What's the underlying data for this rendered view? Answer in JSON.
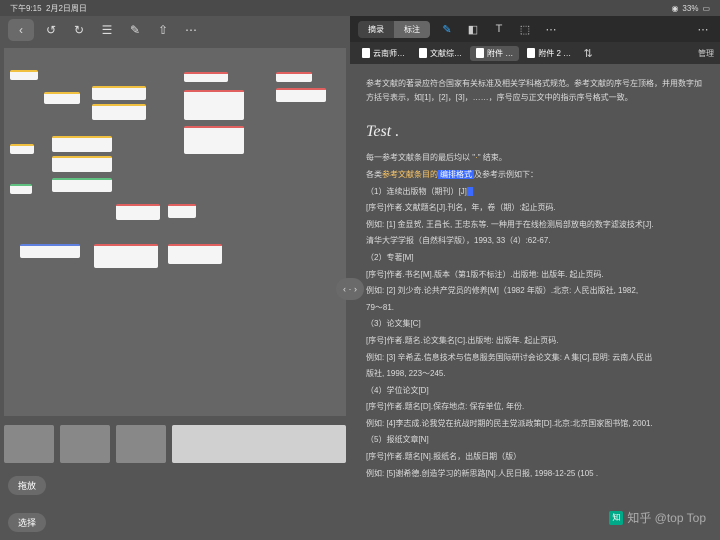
{
  "status": {
    "time": "下午9:15",
    "date": "2月2日周日",
    "battery": "33%"
  },
  "left": {
    "scale": "拖放",
    "select": "选择"
  },
  "seg": {
    "a": "摘录",
    "b": "标注"
  },
  "tabs": [
    "云南师…",
    "文献综…",
    "附件 …",
    "附件 2 …"
  ],
  "manage": "管理",
  "doc": {
    "p1": "参考文献的著录应符合国家有关标准及相关学科格式规范。参考文献的序号左顶格，并用数字加方括号表示，如[1]，[2]，[3]，……，序号应与正文中的指示序号格式一致。",
    "test": "Test .",
    "p2a": "每一参考文献条目的最后均以 \"",
    "p2b": "\" 结束。",
    "p3a": "各类",
    "p3b": "参考文献条目的",
    "p3c": "编排格式",
    "p3d": "及参考示例如下：",
    "s1": "（1）连续出版物（期刊）[J]",
    "s1a": "[序号]作者.文献题名[J].刊名，年，卷（期）:起止页码.",
    "s1b": "例如: [1] 金显贺, 王昌长, 王忠东等. 一种用于在线检测局部放电的数字滤波技术[J].",
    "s1c": "清华大学学报（自然科学版），1993, 33（4）:62-67.",
    "s2": "（2）专著[M]",
    "s2a": "[序号]作者.书名[M].版本（第1版不标注）.出版地: 出版年. 起止页码.",
    "s2b": "例如: [2] 刘少奇.论共产党员的修养[M]（1982 年版）.北京: 人民出版社, 1982,",
    "s2c": "79～81.",
    "s3": "（3）论文集[C]",
    "s3a": "[序号]作者.题名.论文集名[C].出版地: 出版年. 起止页码.",
    "s3b": "例如: [3] 辛希孟.信息技术与信息服务国际研讨会论文集: A 集[C].昆明: 云南人民出",
    "s3c": "版社, 1998, 223～245.",
    "s4": "（4）学位论文[D]",
    "s4a": "[序号]作者.题名[D].保存地点: 保存单位, 年份.",
    "s4b": "例如: [4]李志成.论我党在抗战时期的民主党派政策[D].北京:北京国家图书馆, 2001.",
    "s5": "（5）报纸文章[N]",
    "s5a": "[序号]作者.题名[N].报纸名，出版日期（版）",
    "s5b": "例如: [5]谢希德.创造学习的新思路[N].人民日报, 1998-12-25 (105 ."
  },
  "wm": "知乎 @top Top"
}
